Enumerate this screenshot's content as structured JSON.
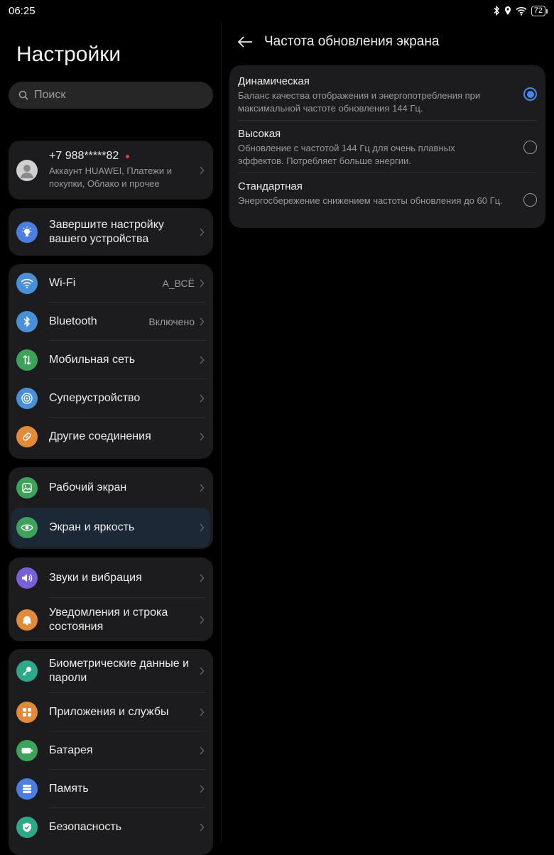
{
  "status": {
    "time": "06:25",
    "battery": "72"
  },
  "left": {
    "title": "Настройки",
    "search_placeholder": "Поиск",
    "account": {
      "phone": "+7 988*****82",
      "subtitle": "Аккаунт HUAWEI, Платежи и покупки, Облако и прочее"
    },
    "setup": {
      "label": "Завершите настройку вашего устройства"
    },
    "connectivity": [
      {
        "label": "Wi-Fi",
        "value": "A_ВСЁ",
        "icon": "wifi-icon",
        "color": "#4a90d9"
      },
      {
        "label": "Bluetooth",
        "value": "Включено",
        "icon": "bluetooth-icon",
        "color": "#4a90d9"
      },
      {
        "label": "Мобильная сеть",
        "value": "",
        "icon": "mobile-network-icon",
        "color": "#3da35a"
      },
      {
        "label": "Суперустройство",
        "value": "",
        "icon": "super-device-icon",
        "color": "#4a90d9"
      },
      {
        "label": "Другие соединения",
        "value": "",
        "icon": "link-icon",
        "color": "#e08a3a"
      }
    ],
    "display_group": [
      {
        "label": "Рабочий экран",
        "icon": "home-screen-icon",
        "color": "#3da35a"
      },
      {
        "label": "Экран и яркость",
        "icon": "eye-icon",
        "color": "#3da35a",
        "active": true
      }
    ],
    "sound_group": [
      {
        "label": "Звуки и вибрация",
        "icon": "speaker-icon",
        "color": "#7b5fd6"
      },
      {
        "label": "Уведомления и строка состояния",
        "icon": "bell-icon",
        "color": "#e08a3a"
      }
    ],
    "system_group": [
      {
        "label": "Биометрические данные и пароли",
        "icon": "key-icon",
        "color": "#2fa889"
      },
      {
        "label": "Приложения и службы",
        "icon": "apps-icon",
        "color": "#e08a3a"
      },
      {
        "label": "Батарея",
        "icon": "battery-icon",
        "color": "#3da35a"
      },
      {
        "label": "Память",
        "icon": "storage-icon",
        "color": "#4a7ee0"
      },
      {
        "label": "Безопасность",
        "icon": "shield-icon",
        "color": "#2fa889"
      }
    ]
  },
  "right": {
    "title": "Частота обновления экрана",
    "options": [
      {
        "title": "Динамическая",
        "desc": "Баланс качества отображения и энергопотребления при максимальной частоте обновления 144 Гц.",
        "selected": true
      },
      {
        "title": "Высокая",
        "desc": "Обновление с частотой 144 Гц для очень плавных эффектов. Потребляет больше энергии.",
        "selected": false
      },
      {
        "title": "Стандартная",
        "desc": "Энергосбережение снижением частоты обновления до 60 Гц.",
        "selected": false
      }
    ]
  },
  "colors": {
    "accent": "#4a86f0",
    "notification_dot": "#e0403a"
  }
}
